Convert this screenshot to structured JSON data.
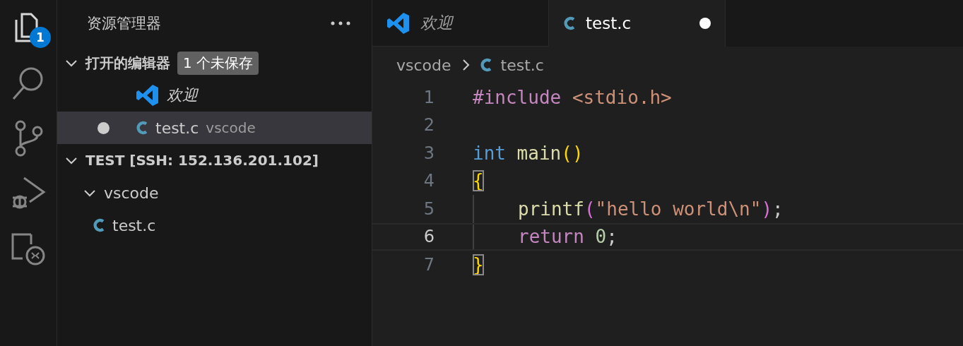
{
  "activity_bar": [
    {
      "kind": "explorer",
      "selected": true,
      "badge": "1"
    },
    {
      "kind": "search",
      "selected": false
    },
    {
      "kind": "source-control",
      "selected": false
    },
    {
      "kind": "run-debug",
      "selected": false
    },
    {
      "kind": "remote",
      "selected": false
    }
  ],
  "sidebar": {
    "title": "资源管理器",
    "open_editors": {
      "label": "打开的编辑器",
      "expanded": true,
      "badge": "1 个未保存",
      "items": [
        {
          "name": "欢迎",
          "kind": "welcome",
          "preview": true,
          "dirty": false,
          "selected": false
        },
        {
          "name": "test.c",
          "kind": "c-file",
          "description": "vscode",
          "preview": false,
          "dirty": true,
          "selected": true
        }
      ]
    },
    "folder": {
      "label": "TEST [SSH: 152.136.201.102]",
      "expanded": true,
      "children": [
        {
          "name": "vscode",
          "kind": "folder",
          "expanded": true,
          "children": [
            {
              "name": "test.c",
              "kind": "c-file"
            }
          ]
        }
      ]
    }
  },
  "tabs": [
    {
      "label": "欢迎",
      "kind": "welcome",
      "preview": true,
      "selected": false,
      "dirty": false
    },
    {
      "label": "test.c",
      "kind": "c-file",
      "preview": false,
      "selected": true,
      "dirty": true
    }
  ],
  "breadcrumb": [
    {
      "text": "vscode",
      "kind": "folder"
    },
    {
      "text": "test.c",
      "kind": "c-file"
    }
  ],
  "editor": {
    "lines": [
      {
        "number": "1",
        "current": false,
        "indent": false,
        "tokens": [
          {
            "text": "#include",
            "kind": "directive"
          },
          {
            "text": " <stdio.h>",
            "kind": "string"
          }
        ]
      },
      {
        "number": "2",
        "current": false,
        "indent": false
      },
      {
        "number": "3",
        "current": false,
        "indent": false,
        "tokens": [
          {
            "text": "int",
            "kind": "type"
          },
          {
            "text": " main",
            "kind": "function"
          },
          {
            "text": "()",
            "kind": "paren"
          }
        ]
      },
      {
        "number": "4",
        "current": false,
        "indent": false,
        "tokens": [
          {
            "text": "{",
            "kind": "bracket-match"
          }
        ]
      },
      {
        "number": "5",
        "current": false,
        "indent": true,
        "tokens": [
          {
            "text": "printf",
            "kind": "function"
          },
          {
            "text": "(",
            "kind": "paren2"
          },
          {
            "text": "\"hello world\\n\"",
            "kind": "string"
          },
          {
            "text": ")",
            "kind": "paren2"
          },
          {
            "text": ";",
            "kind": "plain"
          }
        ]
      },
      {
        "number": "6",
        "current": true,
        "indent": true,
        "tokens": [
          {
            "text": "return",
            "kind": "keyword"
          },
          {
            "text": " 0",
            "kind": "number"
          },
          {
            "text": ";",
            "kind": "plain"
          }
        ]
      },
      {
        "number": "7",
        "current": false,
        "indent": false,
        "tokens": [
          {
            "text": "}",
            "kind": "bracket-match"
          }
        ]
      }
    ]
  }
}
